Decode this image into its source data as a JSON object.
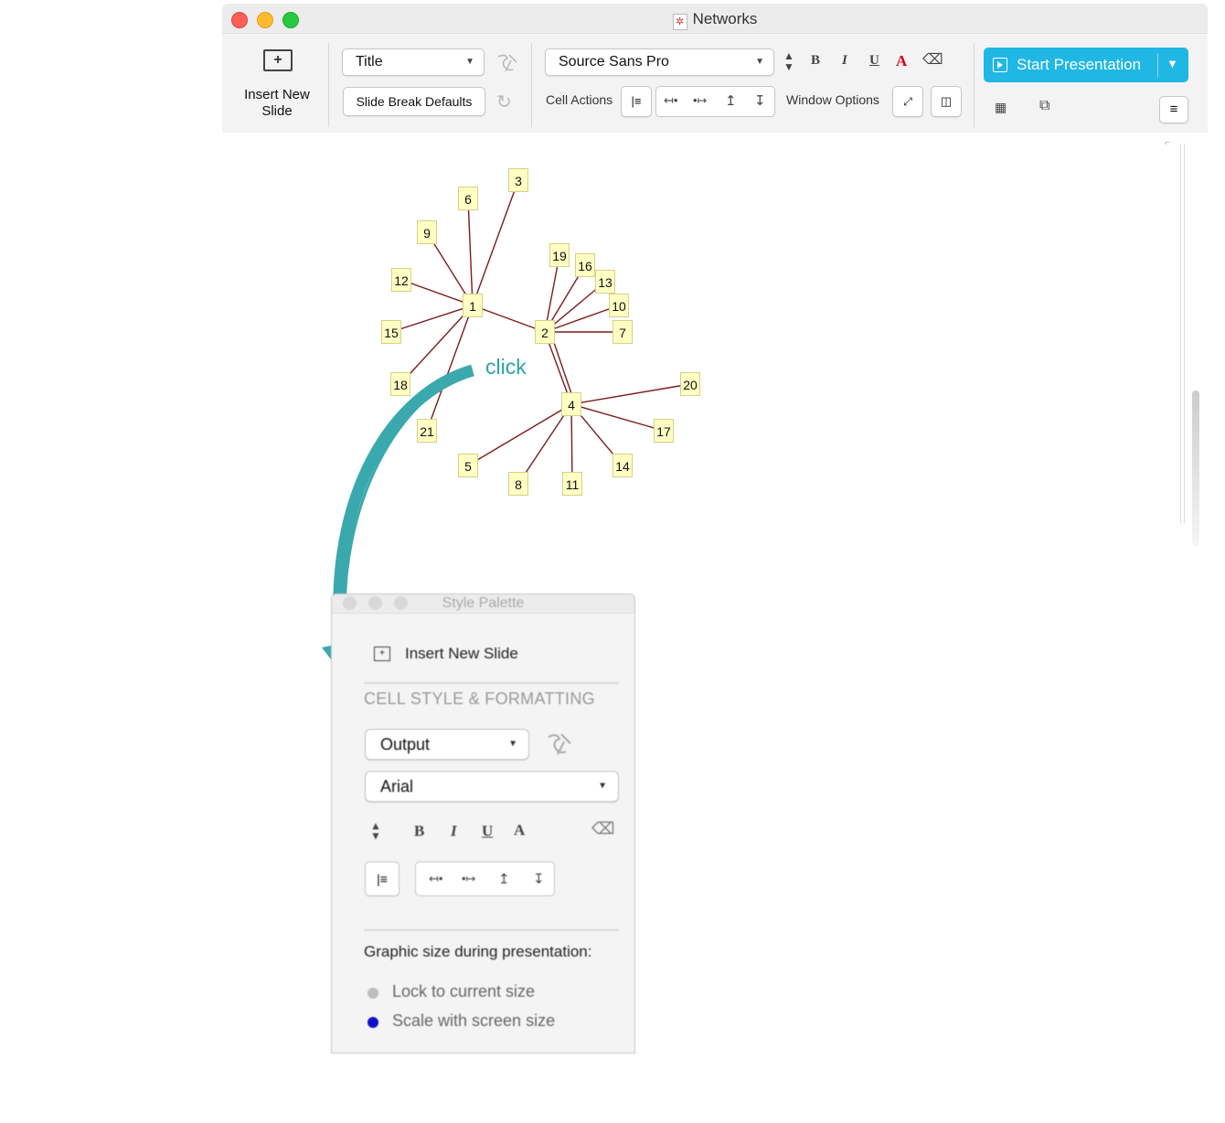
{
  "window": {
    "title": "Networks"
  },
  "toolbar": {
    "insert_new_slide": "Insert New\nSlide",
    "style_select": "Title",
    "slide_break_defaults": "Slide Break Defaults",
    "font_select": "Source Sans Pro",
    "bold": "B",
    "italic": "I",
    "underline": "U",
    "text_color": "A",
    "cell_actions_label": "Cell Actions",
    "window_options_label": "Window Options",
    "start_presentation": "Start Presentation"
  },
  "graph": {
    "annotation": "click",
    "edge_color": "#7a1c1c",
    "node_fill": "#ffffc4",
    "nodes": [
      "1",
      "2",
      "3",
      "4",
      "5",
      "6",
      "7",
      "8",
      "9",
      "10",
      "11",
      "12",
      "13",
      "14",
      "15",
      "16",
      "17",
      "18",
      "19",
      "20",
      "21"
    ]
  },
  "palette": {
    "title": "Style Palette",
    "insert_new_slide": "Insert New Slide",
    "section_heading": "CELL STYLE & FORMATTING",
    "style_select": "Output",
    "font_select": "Arial",
    "bold": "B",
    "italic": "I",
    "underline": "U",
    "text_color": "A",
    "graphic_size_label": "Graphic size during presentation:",
    "options": [
      {
        "label": "Lock to current size",
        "selected": false
      },
      {
        "label": "Scale with screen size",
        "selected": true
      }
    ]
  },
  "colors": {
    "accent": "#20b7e5",
    "arrow": "#3aa9ad",
    "radio_selected": "#1010c8"
  }
}
